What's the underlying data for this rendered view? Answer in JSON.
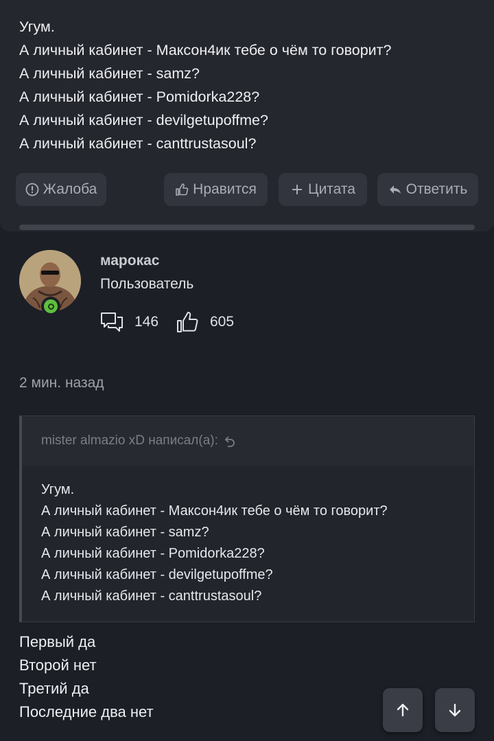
{
  "top_post": {
    "lines": [
      "Угум.",
      "А личный кабинет - Максон4ик тебе о чём то говорит?",
      "А личный кабинет - samz?",
      "А личный кабинет - Pomidorka228?",
      "А личный кабинет - devilgetupoffme?",
      "А личный кабинет - canttrustasoul?"
    ],
    "actions": {
      "report": "Жалоба",
      "like": "Нравится",
      "quote": "Цитата",
      "reply": "Ответить"
    }
  },
  "author": {
    "name": "марокас",
    "role": "Пользователь",
    "messages": "146",
    "likes": "605",
    "online": true
  },
  "post": {
    "time": "2 мин. назад",
    "quote": {
      "header": "mister almazio xD написал(а):",
      "lines": [
        "Угум.",
        "А личный кабинет - Максон4ик тебе о чём то говорит?",
        "А личный кабинет - samz?",
        "А личный кабинет - Pomidorka228?",
        "А личный кабинет - devilgetupoffme?",
        "А личный кабинет - canttrustasoul?"
      ]
    },
    "reply_lines": [
      "Первый да",
      "Второй нет",
      "Третий да",
      "Последние два нет"
    ]
  },
  "icons": {
    "report": "alert-circle-icon",
    "like": "thumbs-up-icon",
    "quote": "plus-icon",
    "reply": "reply-arrow-icon",
    "messages": "chat-bubbles-icon",
    "scroll_up": "arrow-up-icon",
    "scroll_down": "arrow-down-icon"
  },
  "colors": {
    "online": "#5fbf3f",
    "background": "#1c1f26",
    "card": "#25272e"
  }
}
